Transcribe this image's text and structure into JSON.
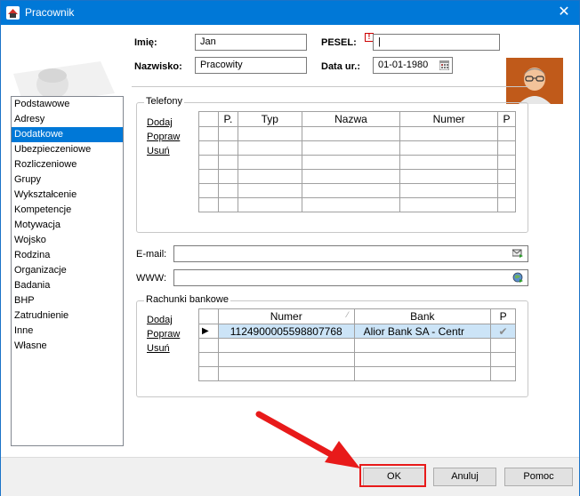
{
  "window": {
    "title": "Pracownik",
    "close_symbol": "✕"
  },
  "header": {
    "imie_label": "Imię:",
    "imie_value": "Jan",
    "nazwisko_label": "Nazwisko:",
    "nazwisko_value": "Pracowity",
    "pesel_label": "PESEL:",
    "pesel_value": "|",
    "pesel_marker": "!",
    "data_label": "Data ur.:",
    "data_value": "01-01-1980"
  },
  "sidebar": {
    "items": [
      "Podstawowe",
      "Adresy",
      "Dodatkowe",
      "Ubezpieczeniowe",
      "Rozliczeniowe",
      "Grupy",
      "Wykształcenie",
      "Kompetencje",
      "Motywacja",
      "Wojsko",
      "Rodzina",
      "Organizacje",
      "Badania",
      "BHP",
      "Zatrudnienie",
      "Inne",
      "Własne"
    ],
    "selected": "Dodatkowe"
  },
  "phones": {
    "title": "Telefony",
    "links": [
      "Dodaj",
      "Popraw",
      "Usuń"
    ],
    "columns": [
      "P.",
      "Typ",
      "Nazwa",
      "Numer",
      "P"
    ]
  },
  "email": {
    "label": "E-mail:",
    "value": ""
  },
  "www": {
    "label": "WWW:",
    "value": ""
  },
  "bank": {
    "title": "Rachunki bankowe",
    "links": [
      "Dodaj",
      "Popraw",
      "Usuń"
    ],
    "columns": [
      "Numer",
      "Bank",
      "P"
    ],
    "sort_glyph": "⁄",
    "row_marker": "▶",
    "rows": [
      {
        "numer": "1124900005598807768",
        "bank": "Alior Bank SA  - Centr",
        "p": "✔"
      }
    ]
  },
  "footer": {
    "ok": "OK",
    "cancel": "Anuluj",
    "help": "Pomoc"
  },
  "colors": {
    "titlebar": "#0078d7",
    "selection": "#0078d7",
    "highlight_frame": "#e81a1a",
    "arrow": "#e81a1a"
  }
}
